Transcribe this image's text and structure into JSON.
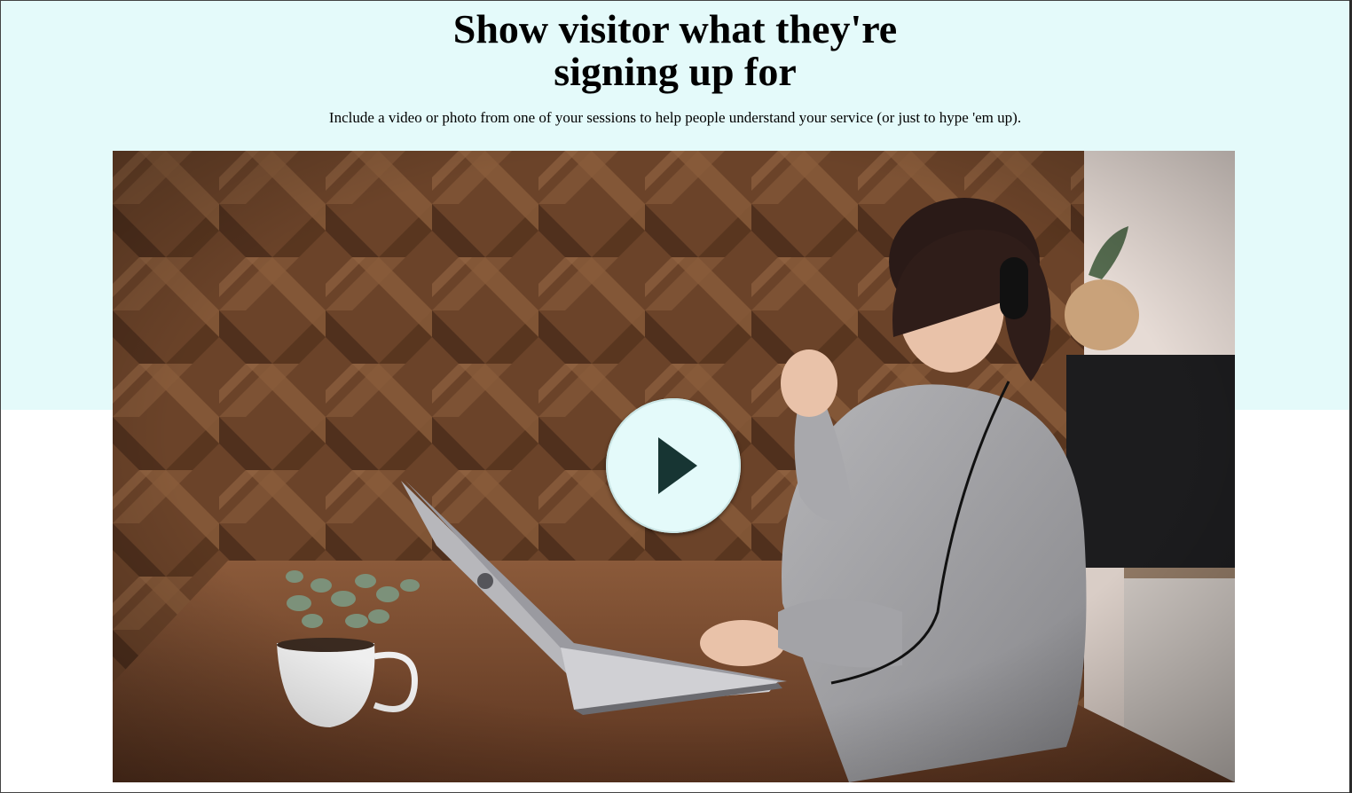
{
  "hero": {
    "title_line_1": "Show visitor what they're",
    "title_line_2": "signing up for",
    "subtitle": "Include a video or photo from one of your sessions to help people understand your service (or just to hype 'em up).",
    "background_color": "#e4fafa"
  },
  "media": {
    "play_icon": "play-icon",
    "play_button_color": "#e4fafa",
    "play_icon_color": "#173533"
  }
}
